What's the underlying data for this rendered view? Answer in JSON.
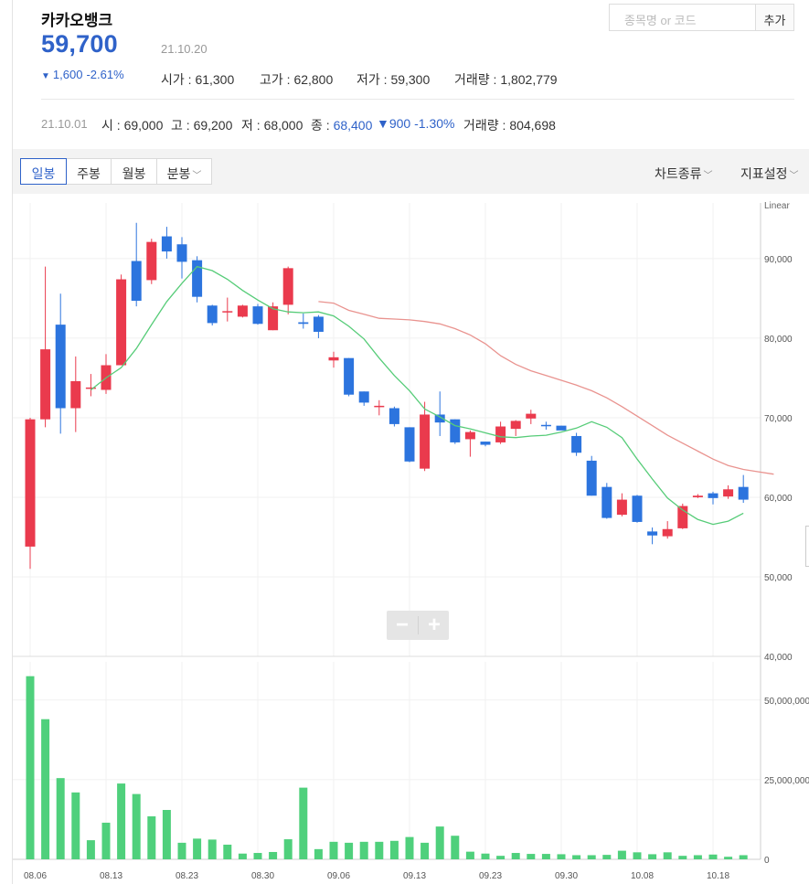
{
  "header": {
    "stock_name": "카카오뱅크",
    "price": "59,700",
    "date": "21.10.20",
    "change_arrow": "▼",
    "change_value": "1,600",
    "change_pct": "-2.61%",
    "open_label": "시가 : ",
    "open": "61,300",
    "high_label": "고가 : ",
    "high": "62,800",
    "low_label": "저가 : ",
    "low": "59,300",
    "volume_label": "거래량 : ",
    "volume": "1,802,779"
  },
  "search": {
    "placeholder": "종목명 or 코드",
    "add_label": "추가"
  },
  "prev_day": {
    "date": "21.10.01",
    "open_label": "시 : ",
    "open": "69,000",
    "high_label": "고 : ",
    "high": "69,200",
    "low_label": "저 : ",
    "low": "68,000",
    "close_label": "종 : ",
    "close": "68,400",
    "change_arrow": "▼",
    "change_value": "900",
    "change_pct": "-1.30%",
    "volume_label": "거래량 : ",
    "volume": "804,698"
  },
  "toolbar": {
    "tabs": [
      "일봉",
      "주봉",
      "월봉",
      "분봉"
    ],
    "active_tab": "일봉",
    "chart_type_label": "차트종류",
    "indicator_label": "지표설정",
    "chevron_icon": "chevron-down-icon"
  },
  "zoom": {
    "minus_label": "−",
    "plus_label": "+"
  },
  "colors": {
    "up": "#ea3a4d",
    "down": "#2c74de",
    "ma_short": "#56cc78",
    "ma_long": "#e9938f",
    "volume": "#4fd07c",
    "accent": "#2f62c9"
  },
  "chart_data": {
    "type": "candlestick",
    "scale_label": "Linear",
    "price_axis": {
      "ylim": [
        40000,
        97000
      ],
      "ticks": [
        "90,000",
        "80,000",
        "70,000",
        "60,000",
        "50,000",
        "40,000"
      ]
    },
    "volume_axis": {
      "ylim": [
        0,
        62000000
      ],
      "ticks": [
        "50,000,000",
        "25,000,000",
        "0"
      ]
    },
    "x_tick_labels": [
      "08.06",
      "08.13",
      "08.23",
      "08.30",
      "09.06",
      "09.13",
      "09.23",
      "09.30",
      "10.08",
      "10.18"
    ],
    "x_tick_index": [
      0,
      5,
      10,
      15,
      20,
      25,
      30,
      35,
      40,
      45
    ],
    "candles": [
      {
        "o": 53800,
        "h": 70000,
        "l": 51000,
        "c": 69800
      },
      {
        "o": 69800,
        "h": 89000,
        "l": 68800,
        "c": 78600
      },
      {
        "o": 81700,
        "h": 85600,
        "l": 68000,
        "c": 71200
      },
      {
        "o": 71200,
        "h": 77700,
        "l": 68200,
        "c": 74600
      },
      {
        "o": 73800,
        "h": 75500,
        "l": 72700,
        "c": 73800
      },
      {
        "o": 73500,
        "h": 78000,
        "l": 73000,
        "c": 76600
      },
      {
        "o": 76600,
        "h": 88000,
        "l": 76600,
        "c": 87400
      },
      {
        "o": 89700,
        "h": 94500,
        "l": 84000,
        "c": 84700
      },
      {
        "o": 87300,
        "h": 92500,
        "l": 86800,
        "c": 92100
      },
      {
        "o": 92800,
        "h": 94000,
        "l": 90000,
        "c": 90900
      },
      {
        "o": 91800,
        "h": 92700,
        "l": 87500,
        "c": 89600
      },
      {
        "o": 89800,
        "h": 90300,
        "l": 84500,
        "c": 85200
      },
      {
        "o": 84100,
        "h": 84200,
        "l": 81600,
        "c": 81900
      },
      {
        "o": 83400,
        "h": 85100,
        "l": 82100,
        "c": 83400
      },
      {
        "o": 82700,
        "h": 84200,
        "l": 82600,
        "c": 84100
      },
      {
        "o": 84000,
        "h": 84300,
        "l": 81700,
        "c": 81800
      },
      {
        "o": 81000,
        "h": 84500,
        "l": 81000,
        "c": 84000
      },
      {
        "o": 84200,
        "h": 89000,
        "l": 83000,
        "c": 88800
      },
      {
        "o": 82000,
        "h": 83100,
        "l": 81200,
        "c": 81800
      },
      {
        "o": 82700,
        "h": 82900,
        "l": 80000,
        "c": 80800
      },
      {
        "o": 77200,
        "h": 78300,
        "l": 76300,
        "c": 77600
      },
      {
        "o": 77500,
        "h": 77500,
        "l": 72700,
        "c": 72900
      },
      {
        "o": 73300,
        "h": 73300,
        "l": 71500,
        "c": 71900
      },
      {
        "o": 71500,
        "h": 72200,
        "l": 70300,
        "c": 71500
      },
      {
        "o": 71200,
        "h": 71400,
        "l": 68900,
        "c": 69200
      },
      {
        "o": 68800,
        "h": 68800,
        "l": 64400,
        "c": 64500
      },
      {
        "o": 63600,
        "h": 72000,
        "l": 63300,
        "c": 70400
      },
      {
        "o": 70400,
        "h": 73300,
        "l": 67700,
        "c": 69400
      },
      {
        "o": 69800,
        "h": 69800,
        "l": 66700,
        "c": 66900
      },
      {
        "o": 67300,
        "h": 68400,
        "l": 65100,
        "c": 68200
      },
      {
        "o": 67000,
        "h": 67000,
        "l": 66400,
        "c": 66600
      },
      {
        "o": 66900,
        "h": 69500,
        "l": 66700,
        "c": 68900
      },
      {
        "o": 68600,
        "h": 69700,
        "l": 67700,
        "c": 69600
      },
      {
        "o": 69900,
        "h": 71000,
        "l": 69200,
        "c": 70500
      },
      {
        "o": 69100,
        "h": 69500,
        "l": 68500,
        "c": 69000
      },
      {
        "o": 69000,
        "h": 69000,
        "l": 68500,
        "c": 68400
      },
      {
        "o": 67700,
        "h": 68100,
        "l": 65200,
        "c": 65600
      },
      {
        "o": 64600,
        "h": 65200,
        "l": 60200,
        "c": 60200
      },
      {
        "o": 61300,
        "h": 61800,
        "l": 57300,
        "c": 57400
      },
      {
        "o": 57800,
        "h": 60500,
        "l": 57600,
        "c": 59700
      },
      {
        "o": 60200,
        "h": 60300,
        "l": 56800,
        "c": 56900
      },
      {
        "o": 55700,
        "h": 56200,
        "l": 54100,
        "c": 55200
      },
      {
        "o": 55100,
        "h": 57000,
        "l": 54800,
        "c": 56000
      },
      {
        "o": 56100,
        "h": 59200,
        "l": 56000,
        "c": 58900
      },
      {
        "o": 60000,
        "h": 60400,
        "l": 59900,
        "c": 60200
      },
      {
        "o": 60500,
        "h": 60700,
        "l": 59100,
        "c": 59900
      },
      {
        "o": 60100,
        "h": 61500,
        "l": 59800,
        "c": 61000
      },
      {
        "o": 61300,
        "h": 62800,
        "l": 59300,
        "c": 59700
      }
    ],
    "ma_short": [
      null,
      null,
      null,
      null,
      73500,
      75000,
      76300,
      78700,
      81700,
      84600,
      86900,
      89000,
      88500,
      87400,
      86000,
      84800,
      83700,
      83300,
      83200,
      83300,
      82800,
      81500,
      79900,
      77500,
      75300,
      73400,
      71100,
      70100,
      69000,
      68600,
      68100,
      67600,
      67500,
      67700,
      67800,
      68200,
      68700,
      69500,
      68800,
      67500,
      64800,
      62300,
      59900,
      58400,
      57200,
      56600,
      57000,
      58000
    ],
    "ma_long": [
      null,
      null,
      null,
      null,
      null,
      null,
      null,
      null,
      null,
      null,
      null,
      null,
      null,
      null,
      null,
      null,
      null,
      null,
      null,
      84600,
      84400,
      83500,
      83000,
      82500,
      82400,
      82300,
      82100,
      81800,
      81200,
      80400,
      79300,
      77800,
      76700,
      75900,
      75300,
      74700,
      74100,
      73400,
      72500,
      71400,
      70200,
      69000,
      67800,
      66800,
      65800,
      64800,
      64000,
      63500,
      63200,
      62900
    ]
  },
  "volume_data": [
    57500000,
    44000000,
    25500000,
    21000000,
    6000000,
    11500000,
    23800000,
    20500000,
    13500000,
    15500000,
    5200000,
    6500000,
    6200000,
    4600000,
    1800000,
    2000000,
    2300000,
    6300000,
    22500000,
    3200000,
    5500000,
    5200000,
    5500000,
    5500000,
    5800000,
    7000000,
    5200000,
    10300000,
    7400000,
    2400000,
    1800000,
    1100000,
    2000000,
    1700000,
    1700000,
    1600000,
    1300000,
    1300000,
    1400000,
    2700000,
    2200000,
    1600000,
    2200000,
    1100000,
    1300000,
    1500000,
    800000,
    1300000
  ]
}
